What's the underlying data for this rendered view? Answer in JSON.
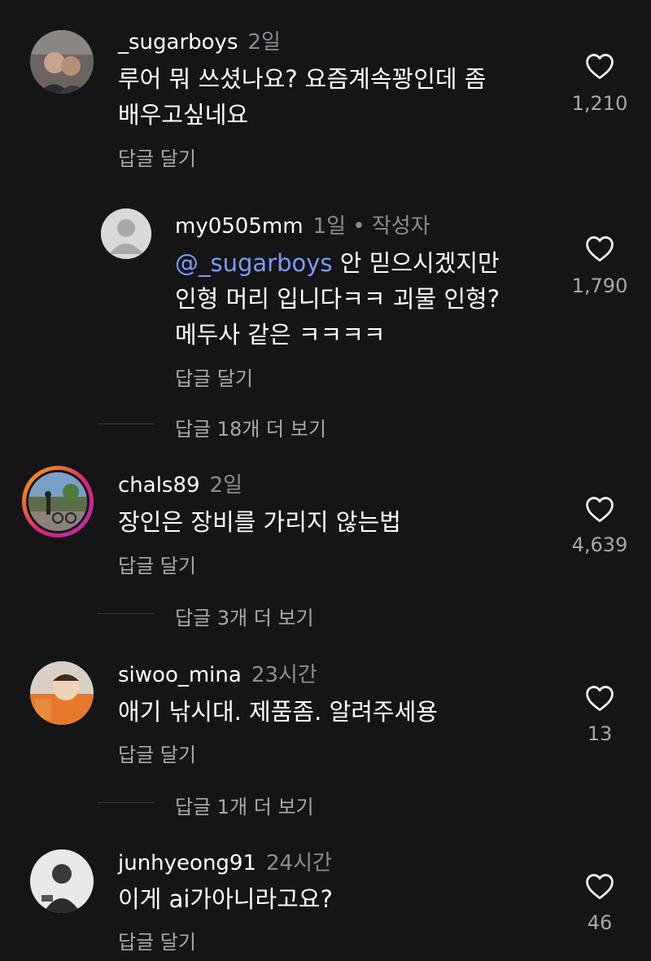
{
  "comments": [
    {
      "username": "_sugarboys",
      "time": "2일",
      "text_line1": "루어 뭐 쓰셨나요? 요즘계속꽝인데 좀",
      "text_line2": "배우고싶네요",
      "reply_label": "답글 달기",
      "likes": "1,210"
    },
    {
      "username": "my0505mm",
      "time": "1일",
      "author_tag": "• 작성자",
      "mention": "@_sugarboys",
      "text_line1": " 안 믿으시겠지만",
      "text_line2": "인형 머리 입니다ㅋㅋ 괴물 인형?",
      "text_line3": "메두사 같은 ㅋㅋㅋㅋ",
      "reply_label": "답글 달기",
      "likes": "1,790",
      "more_replies": "답글 18개 더 보기"
    },
    {
      "username": "chals89",
      "time": "2일",
      "text_line1": "장인은 장비를 가리지 않는법",
      "reply_label": "답글 달기",
      "likes": "4,639",
      "more_replies": "답글 3개 더 보기"
    },
    {
      "username": "siwoo_mina",
      "time": "23시간",
      "text_line1": "애기 낚시대. 제품좀. 알려주세용",
      "reply_label": "답글 달기",
      "likes": "13",
      "more_replies": "답글 1개 더 보기"
    },
    {
      "username": "junhyeong91",
      "time": "24시간",
      "text_line1": "이게 ai가아니라고요?",
      "reply_label": "답글 달기",
      "likes": "46"
    }
  ],
  "icons": {
    "like": "heart-icon",
    "default_avatar": "default-avatar-icon"
  },
  "colors": {
    "background": "#151518",
    "mention": "#7b9cf2",
    "story_ring": "#e0246f"
  }
}
